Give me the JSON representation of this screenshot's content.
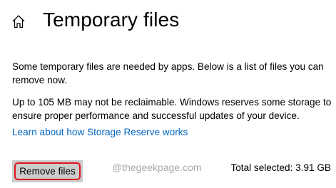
{
  "header": {
    "icon": "home-icon",
    "title": "Temporary files"
  },
  "main": {
    "intro_text": "Some temporary files are needed by apps. Below is a list of files you can remove now.",
    "reserve_text": "Up to 105 MB may not be reclaimable. Windows reserves some storage to ensure proper performance and successful updates of your device.",
    "learn_link": "Learn about how Storage Reserve works",
    "remove_button_label": "Remove files",
    "total_selected": "Total selected: 3.91 GB"
  },
  "watermark": "@thegeekpage.com",
  "colors": {
    "link": "#0067c0",
    "button_bg": "#cccccc",
    "highlight": "#e0141e",
    "watermark": "#a8a8a8"
  }
}
